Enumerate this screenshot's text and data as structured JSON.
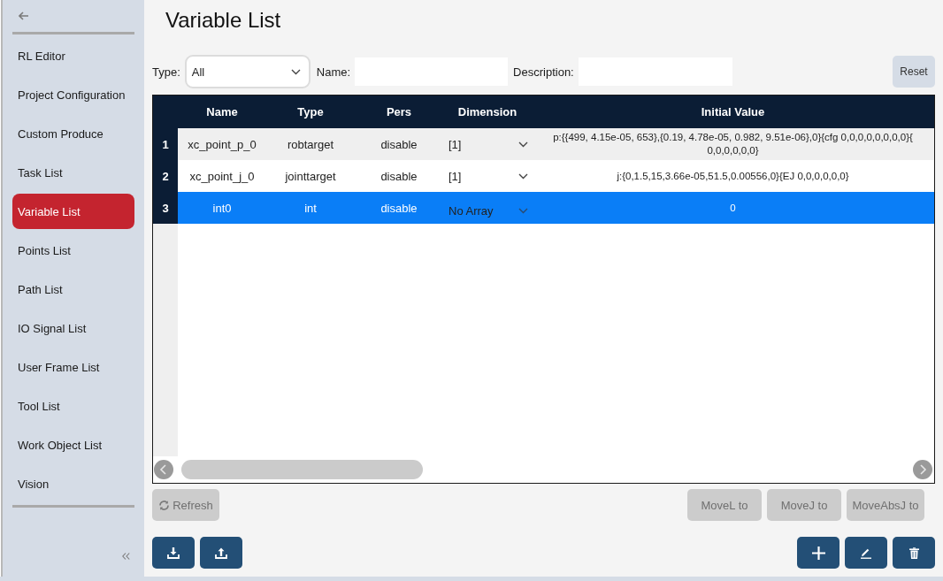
{
  "sidebar": {
    "items": [
      {
        "label": "RL Editor",
        "selected": false
      },
      {
        "label": "Project Configuration",
        "selected": false
      },
      {
        "label": "Custom Produce",
        "selected": false
      },
      {
        "label": "Task List",
        "selected": false
      },
      {
        "label": "Variable List",
        "selected": true
      },
      {
        "label": "Points List",
        "selected": false
      },
      {
        "label": "Path List",
        "selected": false
      },
      {
        "label": "IO Signal List",
        "selected": false
      },
      {
        "label": "User Frame List",
        "selected": false
      },
      {
        "label": "Tool List",
        "selected": false
      },
      {
        "label": "Work Object List",
        "selected": false
      },
      {
        "label": "Vision",
        "selected": false
      }
    ]
  },
  "page_title": "Variable List",
  "filters": {
    "type_label": "Type:",
    "type_value": "All",
    "name_label": "Name:",
    "description_label": "Description:",
    "reset_button": "Reset"
  },
  "table": {
    "columns": [
      "Name",
      "Type",
      "Pers",
      "Dimension",
      "Initial Value"
    ],
    "rows": [
      {
        "number": "1",
        "name": "xc_point_p_0",
        "type": "robtarget",
        "pers": "disable",
        "dimension": "[1]",
        "initial_value": "p:{{499, 4.15e-05, 653},{0.19, 4.78e-05, 0.982, 9.51e-06},0}{cfg 0,0,0,0,0,0,0,0}{ 0,0,0,0,0,0}",
        "selected": false
      },
      {
        "number": "2",
        "name": "xc_point_j_0",
        "type": "jointtarget",
        "pers": "disable",
        "dimension": "[1]",
        "initial_value": "j:{0,1.5,15,3.66e-05,51.5,0.00556,0}{EJ 0,0,0,0,0,0}",
        "selected": false
      },
      {
        "number": "3",
        "name": "int0",
        "type": "int",
        "pers": "disable",
        "dimension": "No Array",
        "initial_value": "0",
        "selected": true
      }
    ]
  },
  "refresh_button": {
    "label": "Refresh",
    "disabled": true
  },
  "move_buttons": [
    {
      "label": "MoveL to",
      "disabled": true
    },
    {
      "label": "MoveJ to",
      "disabled": true
    },
    {
      "label": "MoveAbsJ to",
      "disabled": true
    }
  ]
}
